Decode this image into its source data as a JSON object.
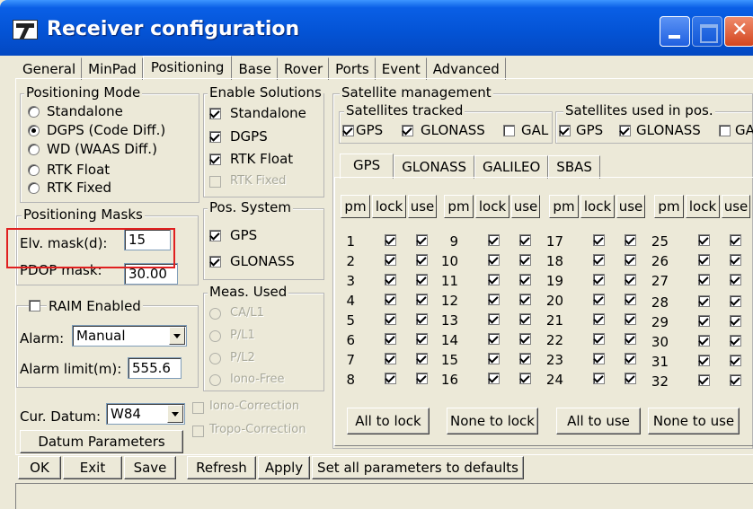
{
  "window": {
    "title": "Receiver configuration"
  },
  "tabs": [
    "General",
    "MinPad",
    "Positioning",
    "Base",
    "Rover",
    "Ports",
    "Event",
    "Advanced"
  ],
  "active_tab": "Positioning",
  "positioning_mode": {
    "legend": "Positioning Mode",
    "options": [
      "Standalone",
      "DGPS (Code Diff.)",
      "WD (WAAS Diff.)",
      "RTK Float",
      "RTK Fixed"
    ],
    "selected": "DGPS (Code Diff.)"
  },
  "enable_solutions": {
    "legend": "Enable Solutions",
    "items": [
      {
        "label": "Standalone",
        "checked": true,
        "enabled": true
      },
      {
        "label": "DGPS",
        "checked": true,
        "enabled": true
      },
      {
        "label": "RTK Float",
        "checked": true,
        "enabled": true
      },
      {
        "label": "RTK Fixed",
        "checked": false,
        "enabled": false
      }
    ]
  },
  "positioning_masks": {
    "legend": "Positioning Masks",
    "elv_label": "Elv. mask(d):",
    "elv_value": "15",
    "pdop_label": "PDOP mask:",
    "pdop_value": "30.00"
  },
  "raim": {
    "label": "RAIM Enabled",
    "checked": false,
    "alarm_label": "Alarm:",
    "alarm_value": "Manual",
    "alarm_limit_label": "Alarm limit(m):",
    "alarm_limit_value": "555.6"
  },
  "pos_system": {
    "legend": "Pos. System",
    "items": [
      {
        "label": "GPS",
        "checked": true
      },
      {
        "label": "GLONASS",
        "checked": true
      }
    ]
  },
  "meas_used": {
    "legend": "Meas. Used",
    "options": [
      "CA/L1",
      "P/L1",
      "P/L2",
      "Iono-Free"
    ]
  },
  "corrections": {
    "iono": "Iono-Correction",
    "tropo": "Tropo-Correction"
  },
  "datum": {
    "label": "Cur. Datum:",
    "value": "W84",
    "button": "Datum Parameters"
  },
  "satellite_management": {
    "legend": "Satellite management",
    "tracked_legend": "Satellites tracked",
    "used_legend": "Satellites used in pos.",
    "tracked": [
      {
        "label": "GPS",
        "checked": true
      },
      {
        "label": "GLONASS",
        "checked": true
      },
      {
        "label": "GAL",
        "checked": false
      }
    ],
    "used": [
      {
        "label": "GPS",
        "checked": true
      },
      {
        "label": "GLONASS",
        "checked": true
      },
      {
        "label": "GA",
        "checked": false
      }
    ],
    "sub_tabs": [
      "GPS",
      "GLONASS",
      "GALILEO",
      "SBAS"
    ],
    "active_sub_tab": "GPS",
    "column_headers": [
      "pm",
      "lock",
      "use"
    ],
    "satellites": [
      1,
      2,
      3,
      4,
      5,
      6,
      7,
      8,
      9,
      10,
      11,
      12,
      13,
      14,
      15,
      16,
      17,
      18,
      19,
      20,
      21,
      22,
      23,
      24,
      25,
      26,
      27,
      28,
      29,
      30,
      31,
      32
    ],
    "lock_all": true,
    "use_all": true,
    "buttons": [
      "All to lock",
      "None to lock",
      "All to use",
      "None to use"
    ]
  },
  "bottom_buttons": [
    "OK",
    "Exit",
    "Save",
    "Refresh",
    "Apply",
    "Set all parameters to defaults"
  ],
  "colors": {
    "titlebar": "#0454d6",
    "face": "#ece9d8",
    "highlight_box": "#e02020"
  }
}
